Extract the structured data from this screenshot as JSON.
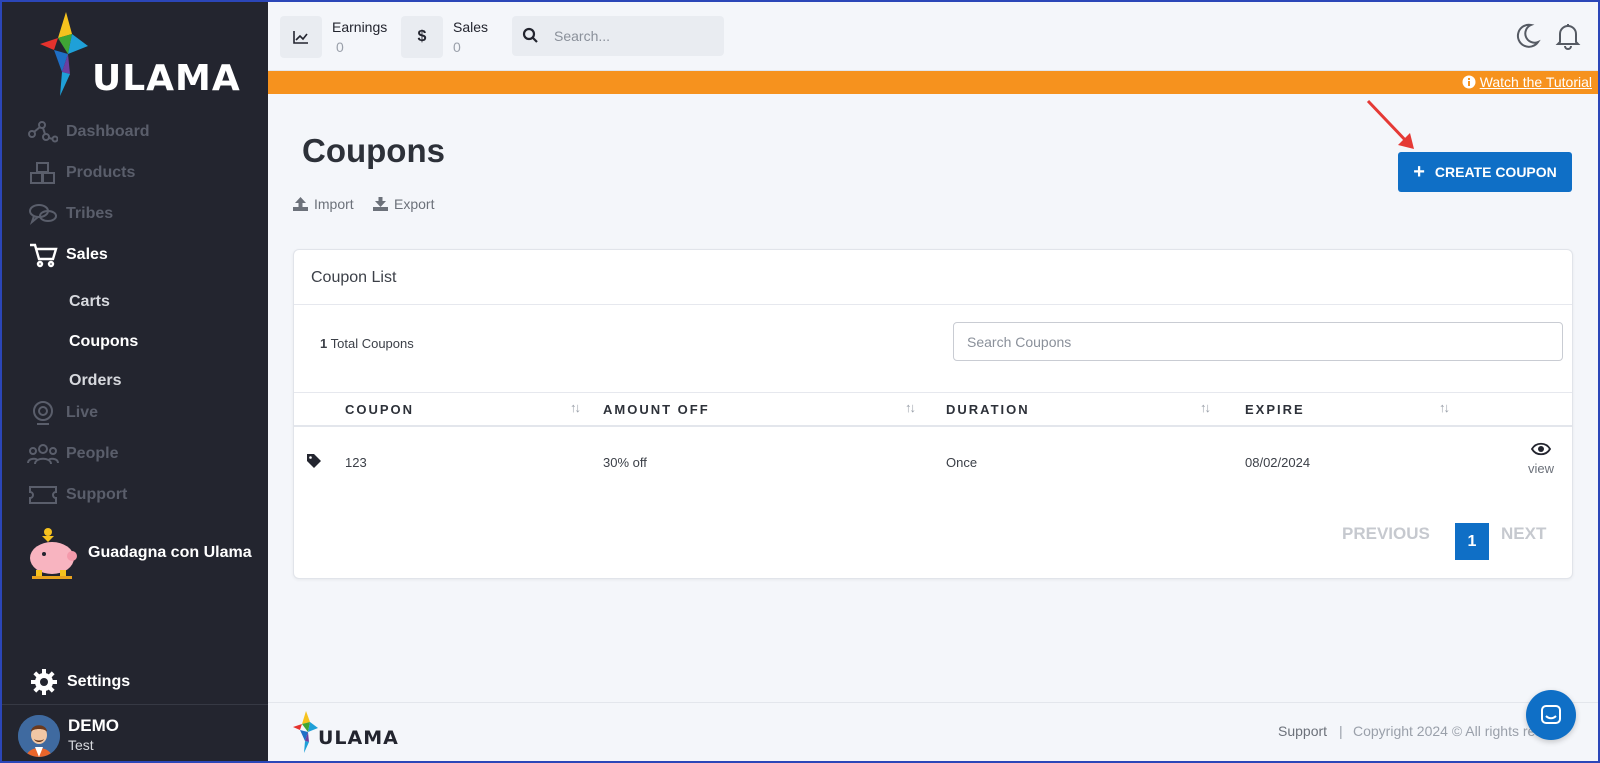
{
  "app": {
    "logo_text": "ULAMA"
  },
  "sidebar": {
    "items": [
      {
        "label": "Dashboard",
        "icon": "dashboard-icon"
      },
      {
        "label": "Products",
        "icon": "products-icon"
      },
      {
        "label": "Tribes",
        "icon": "tribes-icon"
      },
      {
        "label": "Sales",
        "icon": "cart-icon"
      }
    ],
    "sales_sub": [
      {
        "label": "Carts"
      },
      {
        "label": "Coupons"
      },
      {
        "label": "Orders"
      }
    ],
    "items_after": [
      {
        "label": "Live",
        "icon": "live-icon"
      },
      {
        "label": "People",
        "icon": "people-icon"
      },
      {
        "label": "Support",
        "icon": "ticket-icon"
      }
    ],
    "earn_label": "Guadagna con Ulama",
    "settings_label": "Settings",
    "user": {
      "name": "DEMO",
      "subtitle": "Test"
    }
  },
  "topbar": {
    "earnings_label": "Earnings",
    "earnings_value": "0",
    "sales_label": "Sales",
    "sales_value": "0",
    "search_placeholder": "Search..."
  },
  "banner": {
    "link_text": "Watch the Tutorial",
    "color": "#f6921e"
  },
  "page": {
    "title": "Coupons",
    "import_label": "Import",
    "export_label": "Export",
    "create_label": "CREATE COUPON"
  },
  "card": {
    "title": "Coupon List",
    "total_count": "1",
    "total_label": "Total Coupons",
    "search_placeholder": "Search Coupons",
    "columns": [
      "COUPON",
      "AMOUNT OFF",
      "DURATION",
      "EXPIRE"
    ],
    "rows": [
      {
        "coupon": "123",
        "amount_off": "30% off",
        "duration": "Once",
        "expire": "08/02/2024",
        "action": "view"
      }
    ],
    "pagination": {
      "previous": "PREVIOUS",
      "current": "1",
      "next": "NEXT"
    }
  },
  "footer": {
    "logo_text": "ULAMA",
    "support": "Support",
    "separator": "|",
    "copyright": "Copyright 2024 © All rights res"
  },
  "colors": {
    "accent": "#0f6fc6",
    "sidebar": "#23252f"
  }
}
